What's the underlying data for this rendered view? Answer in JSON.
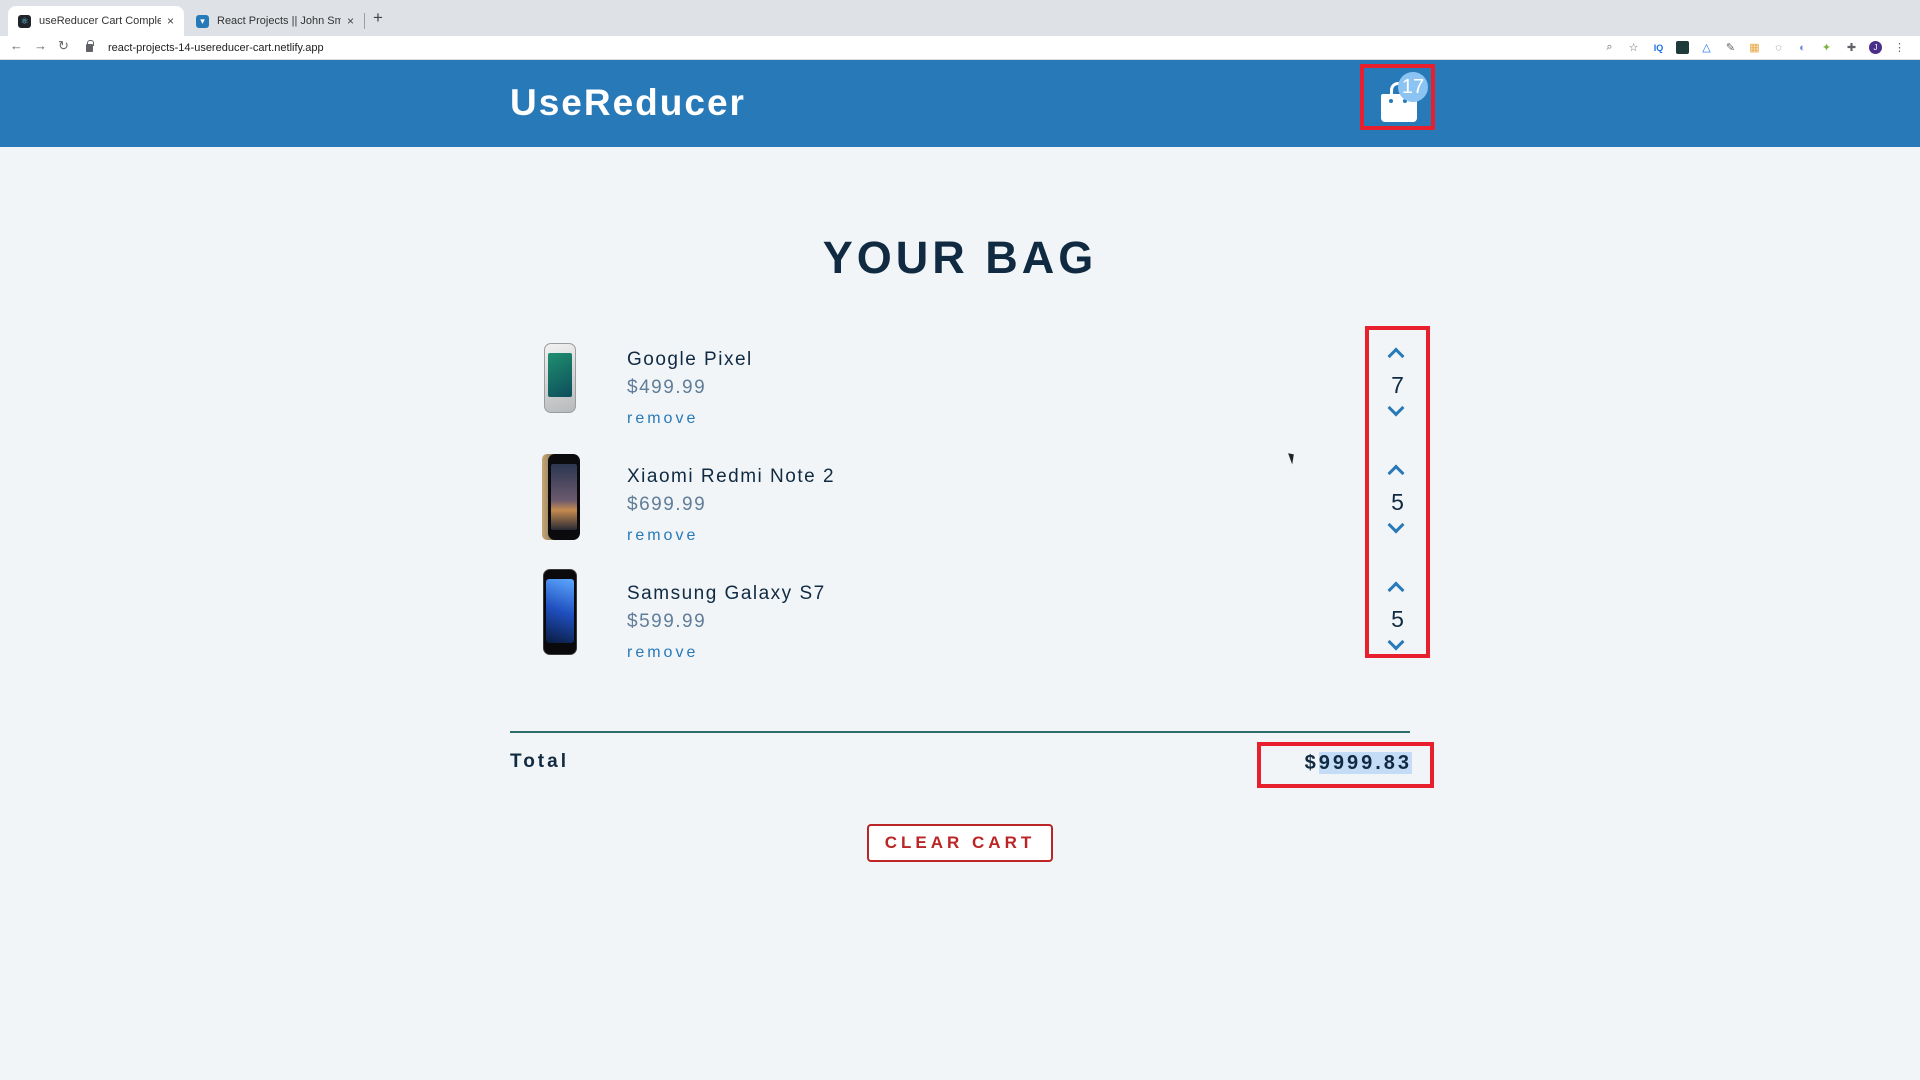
{
  "browser": {
    "tabs": [
      {
        "title": "useReducer Cart Complete",
        "active": true
      },
      {
        "title": "React Projects || John Smilga",
        "active": false
      }
    ],
    "url": "react-projects-14-usereducer-cart.netlify.app",
    "new_tab_label": "+",
    "close_glyph": "×"
  },
  "nav": {
    "brand": "UseReducer",
    "cart_count": "17",
    "cart_icon": "shopping-bag-icon"
  },
  "cart": {
    "title": "YOUR BAG",
    "items": [
      {
        "name": "Google Pixel",
        "price": "$499.99",
        "remove_label": "remove",
        "amount": "7"
      },
      {
        "name": "Xiaomi Redmi Note 2",
        "price": "$699.99",
        "remove_label": "remove",
        "amount": "5"
      },
      {
        "name": "Samsung Galaxy S7",
        "price": "$599.99",
        "remove_label": "remove",
        "amount": "5"
      }
    ],
    "total_label": "Total",
    "total_currency": "$",
    "total_amount": "9999.83",
    "clear_label": "CLEAR CART"
  },
  "colors": {
    "primary": "#2779b8",
    "highlight_border": "#e8202e",
    "clear_button": "#bb2525",
    "background": "#f1f5f8"
  }
}
